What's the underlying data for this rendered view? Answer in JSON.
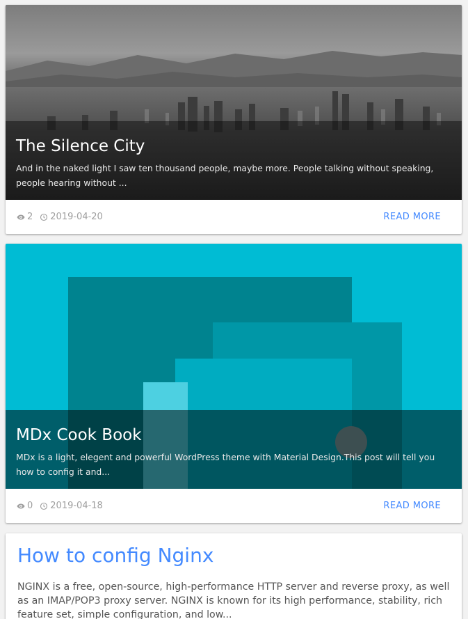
{
  "posts": [
    {
      "title": "The Silence City",
      "excerpt": "And in the naked light I saw ten thousand people, maybe more. People talking without speaking, people hearing without ...",
      "views": "2",
      "date": "2019-04-20",
      "read_more": "READ MORE"
    },
    {
      "title": "MDx Cook Book",
      "excerpt": "MDx is a light, elegent and powerful WordPress theme with Material Design.This post will tell you how to config it and...",
      "views": "0",
      "date": "2019-04-18",
      "read_more": "READ MORE"
    },
    {
      "title": "How to config Nginx",
      "excerpt": "NGINX is a free, open-source, high-performance HTTP server and reverse proxy, as well as an IMAP/POP3 proxy server. NGINX is known for its high performance, stability, rich feature set, simple configuration, and low..."
    }
  ],
  "colors": {
    "accent": "#448aff",
    "cyan": "#00bcd4",
    "meta": "#9e9e9e"
  },
  "icons": [
    "eye-icon",
    "clock-icon"
  ]
}
